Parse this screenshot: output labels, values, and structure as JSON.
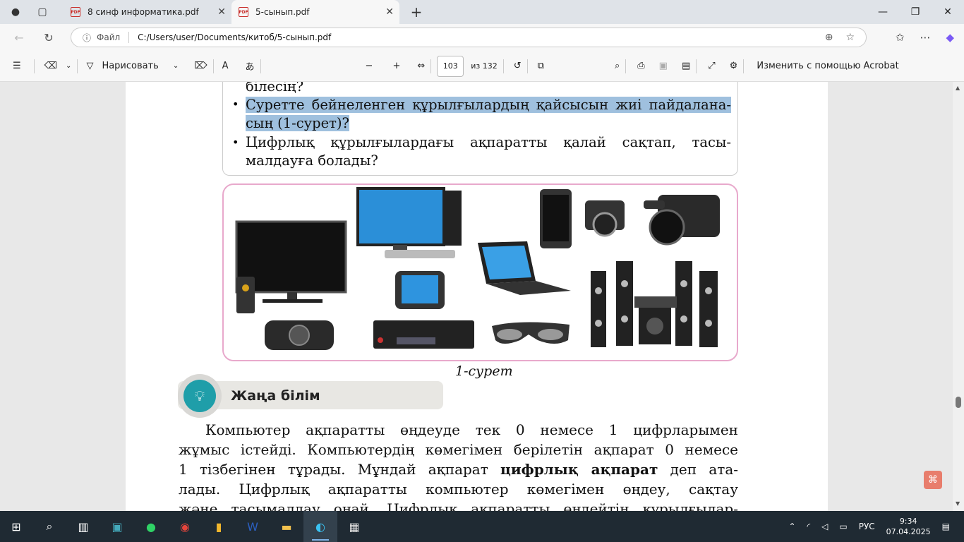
{
  "tabs": [
    {
      "title": "8 синф информатика.pdf"
    },
    {
      "title": "5-сынып.pdf"
    }
  ],
  "address": {
    "info_label": "Файл",
    "path": "C:/Users/user/Documents/китоб/5-сынып.pdf"
  },
  "toolbar": {
    "draw_label": "Нарисовать",
    "page_current": "103",
    "page_total": "из 132",
    "edit_acrobat": "Изменить с помощью Acrobat"
  },
  "doc": {
    "q_top": "білесің?",
    "q1_line1": "Суретте бейнеленген құрылғылардың қайсысын жиі пайдалана-",
    "q1_line2": "сың (1-сурет)?",
    "q2_line1": "Цифрлық құрылғылардағы ақпаратты қалай сақтап, тасы-",
    "q2_line2": "малдауға болады?",
    "caption": "1-сурет",
    "new_knowledge": "Жаңа білім",
    "p_line1": "Компьютер ақпаратты өңдеуде тек 0 немесе 1 цифрларымен",
    "p_line2": "жұмыс істейді. Компьютердің көмегімен берілетін ақпарат 0 немесе",
    "p_line3a": "1 тізбегінен тұрады. Мұндай ақпарат ",
    "p_line3b": "цифрлық ақпарат",
    "p_line3c": " деп ата-",
    "p_line4": "лады. Цифрлық ақпаратты компьютер көмегімен өңдеу, сақтау",
    "p_line5": "және тасымалдау оңай. Цифрлық ақпаратты өңдейтін құрылғылар-"
  },
  "tray": {
    "lang": "РУС",
    "time": "9:34",
    "date": "07.04.2025"
  },
  "colors": {
    "highlight": "#9fc0de",
    "frame_pink": "#e8a9cc",
    "teal": "#1f9ea9"
  }
}
